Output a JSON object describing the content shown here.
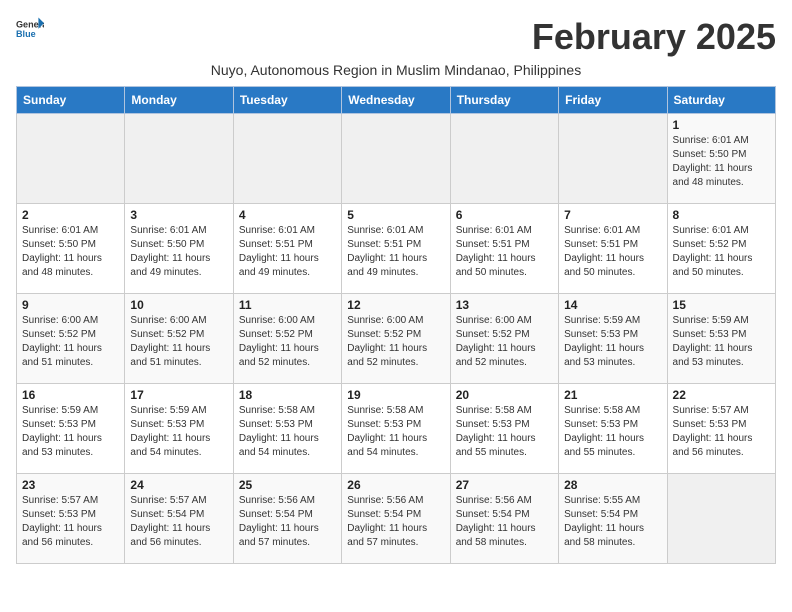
{
  "header": {
    "logo_general": "General",
    "logo_blue": "Blue",
    "month_title": "February 2025",
    "subtitle": "Nuyo, Autonomous Region in Muslim Mindanao, Philippines"
  },
  "calendar": {
    "days_of_week": [
      "Sunday",
      "Monday",
      "Tuesday",
      "Wednesday",
      "Thursday",
      "Friday",
      "Saturday"
    ],
    "weeks": [
      [
        {
          "day": "",
          "info": ""
        },
        {
          "day": "",
          "info": ""
        },
        {
          "day": "",
          "info": ""
        },
        {
          "day": "",
          "info": ""
        },
        {
          "day": "",
          "info": ""
        },
        {
          "day": "",
          "info": ""
        },
        {
          "day": "1",
          "info": "Sunrise: 6:01 AM\nSunset: 5:50 PM\nDaylight: 11 hours and 48 minutes."
        }
      ],
      [
        {
          "day": "2",
          "info": "Sunrise: 6:01 AM\nSunset: 5:50 PM\nDaylight: 11 hours and 48 minutes."
        },
        {
          "day": "3",
          "info": "Sunrise: 6:01 AM\nSunset: 5:50 PM\nDaylight: 11 hours and 49 minutes."
        },
        {
          "day": "4",
          "info": "Sunrise: 6:01 AM\nSunset: 5:51 PM\nDaylight: 11 hours and 49 minutes."
        },
        {
          "day": "5",
          "info": "Sunrise: 6:01 AM\nSunset: 5:51 PM\nDaylight: 11 hours and 49 minutes."
        },
        {
          "day": "6",
          "info": "Sunrise: 6:01 AM\nSunset: 5:51 PM\nDaylight: 11 hours and 50 minutes."
        },
        {
          "day": "7",
          "info": "Sunrise: 6:01 AM\nSunset: 5:51 PM\nDaylight: 11 hours and 50 minutes."
        },
        {
          "day": "8",
          "info": "Sunrise: 6:01 AM\nSunset: 5:52 PM\nDaylight: 11 hours and 50 minutes."
        }
      ],
      [
        {
          "day": "9",
          "info": "Sunrise: 6:00 AM\nSunset: 5:52 PM\nDaylight: 11 hours and 51 minutes."
        },
        {
          "day": "10",
          "info": "Sunrise: 6:00 AM\nSunset: 5:52 PM\nDaylight: 11 hours and 51 minutes."
        },
        {
          "day": "11",
          "info": "Sunrise: 6:00 AM\nSunset: 5:52 PM\nDaylight: 11 hours and 52 minutes."
        },
        {
          "day": "12",
          "info": "Sunrise: 6:00 AM\nSunset: 5:52 PM\nDaylight: 11 hours and 52 minutes."
        },
        {
          "day": "13",
          "info": "Sunrise: 6:00 AM\nSunset: 5:52 PM\nDaylight: 11 hours and 52 minutes."
        },
        {
          "day": "14",
          "info": "Sunrise: 5:59 AM\nSunset: 5:53 PM\nDaylight: 11 hours and 53 minutes."
        },
        {
          "day": "15",
          "info": "Sunrise: 5:59 AM\nSunset: 5:53 PM\nDaylight: 11 hours and 53 minutes."
        }
      ],
      [
        {
          "day": "16",
          "info": "Sunrise: 5:59 AM\nSunset: 5:53 PM\nDaylight: 11 hours and 53 minutes."
        },
        {
          "day": "17",
          "info": "Sunrise: 5:59 AM\nSunset: 5:53 PM\nDaylight: 11 hours and 54 minutes."
        },
        {
          "day": "18",
          "info": "Sunrise: 5:58 AM\nSunset: 5:53 PM\nDaylight: 11 hours and 54 minutes."
        },
        {
          "day": "19",
          "info": "Sunrise: 5:58 AM\nSunset: 5:53 PM\nDaylight: 11 hours and 54 minutes."
        },
        {
          "day": "20",
          "info": "Sunrise: 5:58 AM\nSunset: 5:53 PM\nDaylight: 11 hours and 55 minutes."
        },
        {
          "day": "21",
          "info": "Sunrise: 5:58 AM\nSunset: 5:53 PM\nDaylight: 11 hours and 55 minutes."
        },
        {
          "day": "22",
          "info": "Sunrise: 5:57 AM\nSunset: 5:53 PM\nDaylight: 11 hours and 56 minutes."
        }
      ],
      [
        {
          "day": "23",
          "info": "Sunrise: 5:57 AM\nSunset: 5:53 PM\nDaylight: 11 hours and 56 minutes."
        },
        {
          "day": "24",
          "info": "Sunrise: 5:57 AM\nSunset: 5:54 PM\nDaylight: 11 hours and 56 minutes."
        },
        {
          "day": "25",
          "info": "Sunrise: 5:56 AM\nSunset: 5:54 PM\nDaylight: 11 hours and 57 minutes."
        },
        {
          "day": "26",
          "info": "Sunrise: 5:56 AM\nSunset: 5:54 PM\nDaylight: 11 hours and 57 minutes."
        },
        {
          "day": "27",
          "info": "Sunrise: 5:56 AM\nSunset: 5:54 PM\nDaylight: 11 hours and 58 minutes."
        },
        {
          "day": "28",
          "info": "Sunrise: 5:55 AM\nSunset: 5:54 PM\nDaylight: 11 hours and 58 minutes."
        },
        {
          "day": "",
          "info": ""
        }
      ]
    ]
  }
}
